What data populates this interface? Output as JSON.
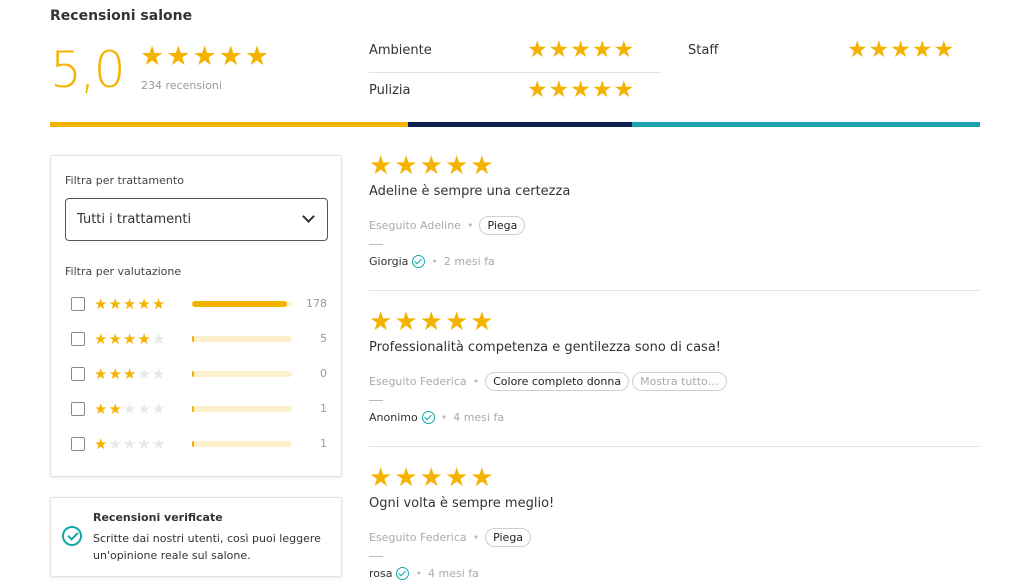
{
  "summary": {
    "title": "Recensioni salone",
    "score": "5,0",
    "stars": 5,
    "count_label": "234 recensioni",
    "categories": [
      {
        "label": "Ambiente",
        "stars": 5
      },
      {
        "label": "Staff",
        "stars": 5
      },
      {
        "label": "Pulizia",
        "stars": 5
      }
    ]
  },
  "colors": {
    "star": "#f5b301",
    "accent_teal": "#14a6a6",
    "bar_yellow": "#f5b301",
    "bar_navy": "#0f1f4f",
    "bar_teal": "#1aa3ad"
  },
  "distribution_bar": [
    {
      "color": "#f5b301",
      "share": 0.385
    },
    {
      "color": "#0f1f4f",
      "share": 0.241
    },
    {
      "color": "#1aa3ad",
      "share": 0.374
    }
  ],
  "filters": {
    "treatment_label": "Filtra per trattamento",
    "treatment_selected": "Tutti i trattamenti",
    "rating_label": "Filtra per valutazione",
    "rows": [
      {
        "stars": 5,
        "count": "178",
        "fraction": 0.95
      },
      {
        "stars": 4,
        "count": "5",
        "fraction": 0.02
      },
      {
        "stars": 3,
        "count": "0",
        "fraction": 0.0
      },
      {
        "stars": 2,
        "count": "1",
        "fraction": 0.02
      },
      {
        "stars": 1,
        "count": "1",
        "fraction": 0.02
      }
    ]
  },
  "verified": {
    "title": "Recensioni verificate",
    "text": "Scritte dai nostri utenti, così puoi leggere un'opinione reale sul salone."
  },
  "reviews": [
    {
      "stars": 5,
      "title": "Adeline è sempre una certezza",
      "done_by": "Eseguito Adeline",
      "treatments": [
        "Piega"
      ],
      "more": "",
      "author": "Giorgia",
      "when": "2 mesi fa"
    },
    {
      "stars": 5,
      "title": "Professionalità competenza e gentilezza sono di casa!",
      "done_by": "Eseguito Federica",
      "treatments": [
        "Colore completo donna"
      ],
      "more": "Mostra tutto…",
      "author": "Anonimo",
      "when": "4 mesi fa"
    },
    {
      "stars": 5,
      "title": "Ogni volta è sempre meglio!",
      "done_by": "Eseguito Federica",
      "treatments": [
        "Piega"
      ],
      "more": "",
      "author": "rosa",
      "when": "4 mesi fa"
    }
  ]
}
